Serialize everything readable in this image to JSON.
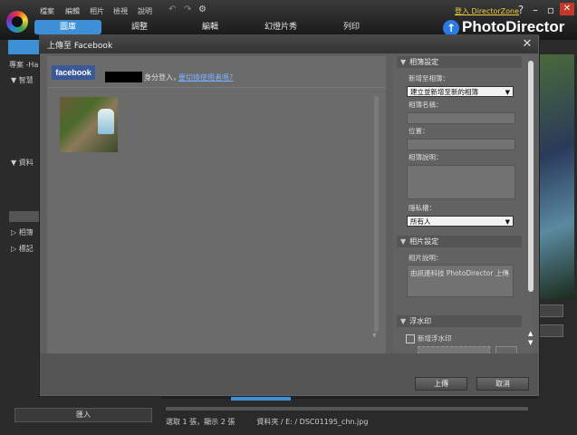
{
  "app": {
    "menu": [
      "檔案",
      "編輯",
      "相片",
      "檢視",
      "說明"
    ],
    "login_link": "登入 DirectorZone",
    "help": "?",
    "brand": "PhotoDirector",
    "tabs": [
      "圖庫",
      "調整",
      "編輯",
      "幻燈片秀",
      "列印"
    ],
    "left_panel": {
      "project": "專案 -Ha",
      "items": [
        "智慧",
        "資料",
        "相簿",
        "標記"
      ],
      "import_button": "匯入"
    },
    "status": "選取 1 張，顯示 2 張　　　資料夾 / E: / DSC01195_chn.jpg"
  },
  "dialog": {
    "title": "上傳至 Facebook",
    "facebook_logo": "facebook",
    "login_as": "身分登入，",
    "switch_user": "要切換使用者嗎?",
    "album_section": {
      "title": "相簿設定",
      "add_to_album_label": "新增至相簿：",
      "add_to_album_value": "建立並新增至新的相簿",
      "album_name_label": "相簿名稱：",
      "location_label": "位置：",
      "description_label": "相簿說明："
    },
    "privacy_label": "隱私權：",
    "privacy_value": "所有人",
    "photo_section": {
      "title": "相片設定",
      "description_label": "相片說明：",
      "description_value": "由訊連科技 PhotoDirector 上傳"
    },
    "watermark_section": {
      "title": "浮水印",
      "add_watermark_label": "新增浮水印"
    },
    "upload_button": "上傳",
    "cancel_button": "取消"
  }
}
